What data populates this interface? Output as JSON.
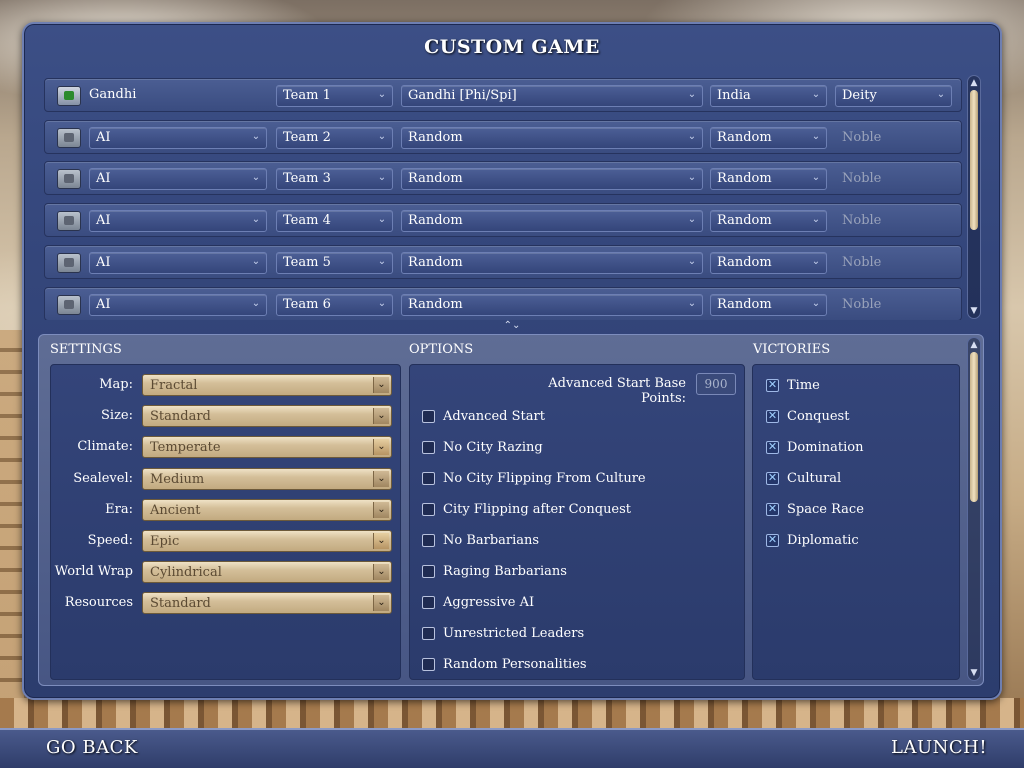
{
  "title": "CUSTOM GAME",
  "players": [
    {
      "icon": "human-player-icon",
      "name": "Gandhi",
      "name_select": "",
      "team": "Team 1",
      "leader": "Gandhi [Phi/Spi]",
      "civ": "India",
      "difficulty": "Deity",
      "difficulty_dropdown": true
    },
    {
      "icon": "ai-player-icon",
      "name": "",
      "name_select": "AI",
      "team": "Team 2",
      "leader": "Random",
      "civ": "Random",
      "difficulty": "Noble",
      "difficulty_dropdown": false
    },
    {
      "icon": "ai-player-icon",
      "name": "",
      "name_select": "AI",
      "team": "Team 3",
      "leader": "Random",
      "civ": "Random",
      "difficulty": "Noble",
      "difficulty_dropdown": false
    },
    {
      "icon": "ai-player-icon",
      "name": "",
      "name_select": "AI",
      "team": "Team 4",
      "leader": "Random",
      "civ": "Random",
      "difficulty": "Noble",
      "difficulty_dropdown": false
    },
    {
      "icon": "ai-player-icon",
      "name": "",
      "name_select": "AI",
      "team": "Team 5",
      "leader": "Random",
      "civ": "Random",
      "difficulty": "Noble",
      "difficulty_dropdown": false
    },
    {
      "icon": "ai-player-icon",
      "name": "",
      "name_select": "AI",
      "team": "Team 6",
      "leader": "Random",
      "civ": "Random",
      "difficulty": "Noble",
      "difficulty_dropdown": false
    }
  ],
  "sections": {
    "settings": "SETTINGS",
    "options": "OPTIONS",
    "victories": "VICTORIES"
  },
  "settings": [
    {
      "label": "Map:",
      "value": "Fractal",
      "arrow_style": "dark"
    },
    {
      "label": "Size:",
      "value": "Standard",
      "arrow_style": "dark"
    },
    {
      "label": "Climate:",
      "value": "Temperate",
      "arrow_style": "gold"
    },
    {
      "label": "Sealevel:",
      "value": "Medium",
      "arrow_style": "dark"
    },
    {
      "label": "Era:",
      "value": "Ancient",
      "arrow_style": "dark"
    },
    {
      "label": "Speed:",
      "value": "Epic",
      "arrow_style": "gold"
    },
    {
      "label": "World Wrap",
      "value": "Cylindrical",
      "arrow_style": "dark"
    },
    {
      "label": "Resources",
      "value": "Standard",
      "arrow_style": "dark"
    }
  ],
  "advanced_start": {
    "label": "Advanced Start Base Points:",
    "value": "900"
  },
  "options": [
    {
      "label": "Advanced Start",
      "checked": false
    },
    {
      "label": "No City Razing",
      "checked": false
    },
    {
      "label": "No City Flipping From Culture",
      "checked": false
    },
    {
      "label": "City Flipping after Conquest",
      "checked": false
    },
    {
      "label": "No Barbarians",
      "checked": false
    },
    {
      "label": "Raging Barbarians",
      "checked": false
    },
    {
      "label": "Aggressive AI",
      "checked": false
    },
    {
      "label": "Unrestricted Leaders",
      "checked": false
    },
    {
      "label": "Random Personalities",
      "checked": false
    }
  ],
  "victories": [
    {
      "label": "Time",
      "checked": true
    },
    {
      "label": "Conquest",
      "checked": true
    },
    {
      "label": "Domination",
      "checked": true
    },
    {
      "label": "Cultural",
      "checked": true
    },
    {
      "label": "Space Race",
      "checked": true
    },
    {
      "label": "Diplomatic",
      "checked": true
    }
  ],
  "footer": {
    "back_label": "GO BACK",
    "launch_label": "LAUNCH!"
  },
  "colors": {
    "panel": "#34467b",
    "gold_select": "#d4bf99",
    "text": "#ffffff"
  }
}
